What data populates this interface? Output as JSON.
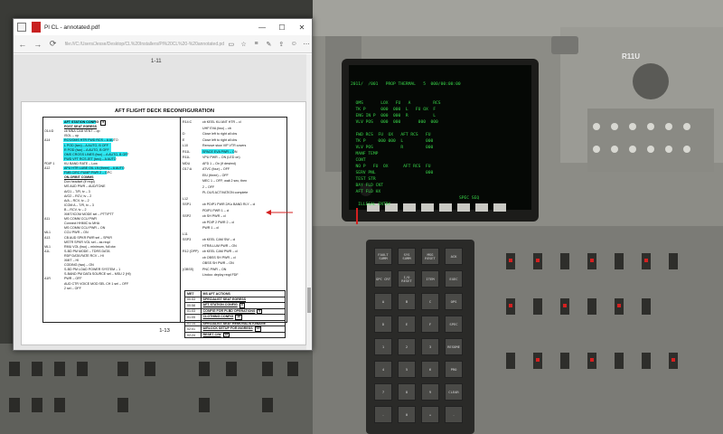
{
  "window": {
    "title": "Pl CL - annotated.pdf",
    "url": "file:///C:/Users/Jesse/Desktop/CL%20Installers/Pl%20CL%20-%20annotated.pdf",
    "controls": [
      "—",
      "☐",
      "✕"
    ]
  },
  "nav": {
    "back": "←",
    "forward": "→",
    "refresh": "⟳",
    "tools": [
      "▭",
      "☆",
      "≡",
      "✎",
      "⇪",
      "☺",
      "⋯"
    ]
  },
  "pages": {
    "top_page_number": "1-11",
    "current_page_number": "1-13"
  },
  "document": {
    "title": "AFT FLIGHT DECK RECONFIGURATION",
    "left_column": [
      {
        "cat": "",
        "text": "AFT STATION CONFIG",
        "box": "5",
        "bold": true,
        "highlight": true
      },
      {
        "cat": "",
        "text": "POST SEAT EGRESS",
        "underline": true,
        "bold": true
      },
      {
        "cat": "O14:D",
        "text": "cb MNA CAB VENT  – op"
      },
      {
        "cat": "",
        "text": "ISOL – op"
      },
      {
        "cat": "A14",
        "text": "RCS/OMS HTR FWD RCS  – A AUTO",
        "highlight": true
      },
      {
        "cat": "",
        "text": "L POD (two)  – A AUTO, B OFF",
        "highlight": true
      },
      {
        "cat": "",
        "text": "R POD (two)  – A AUTO, B OFF",
        "highlight": true
      },
      {
        "cat": "",
        "text": "OMS CROSS LINES (two)  – A AUTO, B OFF",
        "highlight": true
      },
      {
        "cat": "",
        "text": "FWD VFT RCS JET (two)  – A AUTO",
        "highlight": true
      },
      {
        "cat": "PDIP 1",
        "text": "KU BAND RATE  – Low"
      },
      {
        "cat": "A12",
        "text": "APU HTR LUBE OIL LN (three) – A AUTO",
        "highlight": true
      },
      {
        "cat": "",
        "text": "FMB CIRC PUMP PWR 2 – GPC",
        "highlight": true
      },
      {
        "cat": "",
        "text": "ON-ORBIT COMMS",
        "underline": true,
        "bold": true
      },
      {
        "cat": "",
        "text": "Don headset (if reqd)"
      },
      {
        "cat": "",
        "text": "MS AUD PWR  – AUD/TONE"
      },
      {
        "cat": "",
        "text": "A/G1  – T/R, tv – 3"
      },
      {
        "cat": "",
        "text": "A/G2  – RCV, tv – 2"
      },
      {
        "cat": "",
        "text": "A/A  – RCV, tv – 2"
      },
      {
        "cat": "",
        "text": "ICOM A  – T/R, tv – 3"
      },
      {
        "cat": "",
        "text": "B  – RCV, tv – 2"
      },
      {
        "cat": "",
        "text": "XMIT/ICOM MODE sel – PTT/PTT"
      },
      {
        "cat": "A11",
        "text": "MS COMM CCU PWR"
      },
      {
        "cat": "",
        "text": "Connect HHMIC to MHA"
      },
      {
        "cat": "",
        "text": "MS COMM CCU PWR  – ON"
      },
      {
        "cat": "ML1",
        "text": "CCU PWR  – ON"
      },
      {
        "cat": "A13",
        "text": "CB AUD SPKR PWR sel  – SPKR"
      },
      {
        "cat": "",
        "text": "MSTR SPKR VOL sel – as reqd"
      },
      {
        "cat": "ML1",
        "text": "RMU VOL (two)  – minimum, full ctw"
      },
      {
        "cat": "A1L",
        "text": "S-BD PM MODE  – TDRS DATA"
      },
      {
        "cat": "",
        "text": "RDP DATA RATE RCV  – HI"
      },
      {
        "cat": "",
        "text": "XMIT  – HI"
      },
      {
        "cat": "",
        "text": "CODING (two)  – ON"
      },
      {
        "cat": "",
        "text": "S-BD PM LOAD POWER SYSTEM – 1"
      },
      {
        "cat": "",
        "text": "S-BAND PM DATA SOURCE sel – MSU 2 (HI)"
      },
      {
        "cat": "A1R",
        "text": "PWR  – OFF"
      },
      {
        "cat": "",
        "text": "AUD CTR VOICE MOD SEL CH 1 sel – OFF"
      },
      {
        "cat": "",
        "text": "2 sel – OFF"
      }
    ],
    "right_column": [
      {
        "cat": "R14:C",
        "text": "cb KEEL KU ANT HTR – cl"
      },
      {
        "cat": "",
        "text": "UHF EVA (two) – cb"
      },
      {
        "cat": "D",
        "text": "Close left to right all cbs"
      },
      {
        "cat": "E",
        "text": "Close left to right all cbs"
      },
      {
        "cat": "L10",
        "text": "Remove stow VIP VTR covers"
      },
      {
        "cat": "R11L",
        "text": "SPACE EVA PWR – ON",
        "highlight": true
      },
      {
        "cat": "R11L",
        "text": "VPU PWR – ON (LED on)"
      },
      {
        "cat": "MDU",
        "text": "AFD 1 – On (if desired)"
      },
      {
        "cat": "O17:A",
        "text": "ATVC (four) – OFF"
      },
      {
        "cat": "",
        "text": "EIU (three) – OFF"
      },
      {
        "cat": "",
        "text": "MEC 1 – OFF; wait 2 sec, then"
      },
      {
        "cat": "",
        "text": "2 – OFF"
      },
      {
        "cat": "",
        "text": "PL DUS ACTIVATION complete"
      },
      {
        "cat": "L12",
        "text": ""
      },
      {
        "cat": "SSP1",
        "text": "cb PDIP1 PWR 2/Ku BAND RLY – cl"
      },
      {
        "cat": "",
        "text": "PDIP1 PWR 1 – cl"
      },
      {
        "cat": "SSP2",
        "text": "cb SH PWR – cl"
      },
      {
        "cat": "",
        "text": "cb PDIP 2 PWR 2 – cl"
      },
      {
        "cat": "",
        "text": "PWR 1 – cl"
      },
      {
        "cat": "L11",
        "text": ""
      },
      {
        "cat": "SSP3",
        "text": "cb KEEL CAM SW – cl"
      },
      {
        "cat": "",
        "text": "HTR/ILLUM PWR – ON"
      },
      {
        "cat": "R12 (OPP)",
        "text": "cb KEEL CAM PWR – cl"
      },
      {
        "cat": "",
        "text": "cb OBSS SH PWR – cl"
      },
      {
        "cat": "",
        "text": "OBSS SH PWR – ON"
      },
      {
        "cat": "(OBSS)",
        "text": "PNC PWR – ON"
      },
      {
        "cat": "",
        "text": "Lindoo: deploy reqd FDF"
      }
    ],
    "ms_table": {
      "header": [
        "MET",
        "MS AFT ACTIONS"
      ],
      "rows": [
        {
          "met": "00:53",
          "action": "SPECIALIST SEAT EGRESS",
          "box": ""
        },
        {
          "met": "00:58",
          "action": "AFT STATION CONFIG",
          "box": "5"
        },
        {
          "met": "01:03",
          "action": "CONFIG FOR PLBD OPERATIONS",
          "box": "6"
        },
        {
          "met": "01:05",
          "action": "CLOTHING CONFIG",
          "box": "10"
        },
        {
          "met": "01:14",
          "action": "SPECIALIST SEAT REMOVAL/STOWAGE",
          "box": ""
        },
        {
          "met": "02:01",
          "action": "AIRLOCK SETUP FOR INGRESS",
          "box": "13"
        },
        {
          "met": "02:24",
          "action": "RESET C/W",
          "box": "15"
        }
      ]
    }
  },
  "cockpit": {
    "panel_label": "R11U",
    "crt_header": "2011/  /001   PROP THERMAL   5  000/00:00:00",
    "crt_lines": [
      "  OMS       LOX   FU   A         RCS",
      "  TK P      000  000  L   FU OX  F",
      "  ENG IN P  000  000  R          L",
      "  VLV POS   000  000       000  000",
      "",
      "  FWD RCS  FU  OX   AFT RCS   FU",
      "  TK P     000 000  L         000",
      "  VLV POS           R         000",
      "  MANF TEMP",
      "  CONT",
      "  NO P   FU  OX      AFT RCS  FU",
      "  SERV PNL                    000",
      "  TEST STR",
      "  BAY FLD CNT",
      "  AFT FLD HX",
      "",
      "   ILLEGAL ENTRY"
    ],
    "crt_footer": "SPEC SEQ",
    "keypad": [
      [
        "FAULT SUMM",
        "SYS SUMM",
        "MSG RESET",
        "ACK"
      ],
      [
        "GPC CRT",
        "I/O RESET",
        "ITEM",
        "EXEC"
      ],
      [
        "A",
        "B",
        "C",
        "OPS"
      ],
      [
        "D",
        "E",
        "F",
        "SPEC"
      ],
      [
        "1",
        "2",
        "3",
        "RESUME"
      ],
      [
        "4",
        "5",
        "6",
        "PRO"
      ],
      [
        "7",
        "8",
        "9",
        "CLEAR"
      ],
      [
        "-",
        "0",
        "+",
        "."
      ]
    ]
  },
  "colors": {
    "highlight": "#2ee6f0",
    "arrow": "#d42020",
    "crt_green": "#39d84a",
    "panel_grey": "#8f8f8a"
  }
}
